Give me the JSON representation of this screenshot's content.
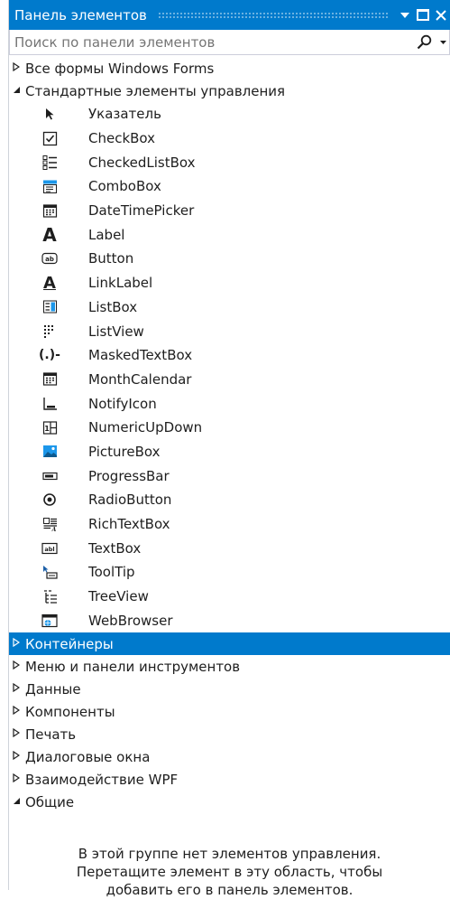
{
  "panel": {
    "title": "Панель элементов",
    "search_placeholder": "Поиск по панели элементов"
  },
  "categories_before": [
    {
      "label": "Все формы Windows Forms",
      "expanded": false
    }
  ],
  "standard": {
    "label": "Стандартные элементы управления",
    "expanded": true,
    "items": [
      {
        "label": "Указатель",
        "icon": "pointer-icon"
      },
      {
        "label": "CheckBox",
        "icon": "checkbox-icon"
      },
      {
        "label": "CheckedListBox",
        "icon": "checkedlistbox-icon"
      },
      {
        "label": "ComboBox",
        "icon": "combobox-icon"
      },
      {
        "label": "DateTimePicker",
        "icon": "datetimepicker-icon"
      },
      {
        "label": "Label",
        "icon": "label-icon"
      },
      {
        "label": "Button",
        "icon": "button-icon"
      },
      {
        "label": "LinkLabel",
        "icon": "linklabel-icon"
      },
      {
        "label": "ListBox",
        "icon": "listbox-icon"
      },
      {
        "label": "ListView",
        "icon": "listview-icon"
      },
      {
        "label": "MaskedTextBox",
        "icon": "maskedtextbox-icon"
      },
      {
        "label": "MonthCalendar",
        "icon": "monthcalendar-icon"
      },
      {
        "label": "NotifyIcon",
        "icon": "notifyicon-icon"
      },
      {
        "label": "NumericUpDown",
        "icon": "numericupdown-icon"
      },
      {
        "label": "PictureBox",
        "icon": "picturebox-icon"
      },
      {
        "label": "ProgressBar",
        "icon": "progressbar-icon"
      },
      {
        "label": "RadioButton",
        "icon": "radiobutton-icon"
      },
      {
        "label": "RichTextBox",
        "icon": "richtextbox-icon"
      },
      {
        "label": "TextBox",
        "icon": "textbox-icon"
      },
      {
        "label": "ToolTip",
        "icon": "tooltip-icon"
      },
      {
        "label": "TreeView",
        "icon": "treeview-icon"
      },
      {
        "label": "WebBrowser",
        "icon": "webbrowser-icon"
      }
    ]
  },
  "categories_after": [
    {
      "label": "Контейнеры",
      "expanded": false,
      "selected": true
    },
    {
      "label": "Меню и панели инструментов",
      "expanded": false
    },
    {
      "label": "Данные",
      "expanded": false
    },
    {
      "label": "Компоненты",
      "expanded": false
    },
    {
      "label": "Печать",
      "expanded": false
    },
    {
      "label": "Диалоговые окна",
      "expanded": false
    },
    {
      "label": "Взаимодействие WPF",
      "expanded": false
    },
    {
      "label": "Общие",
      "expanded": true
    }
  ],
  "empty_group": {
    "line1": "В этой группе нет элементов управления.",
    "line2": "Перетащите элемент в эту область, чтобы",
    "line3": "добавить его в панель элементов."
  },
  "colors": {
    "accent": "#007acc",
    "border": "#cccedb",
    "placeholder": "#6d6d6d"
  }
}
